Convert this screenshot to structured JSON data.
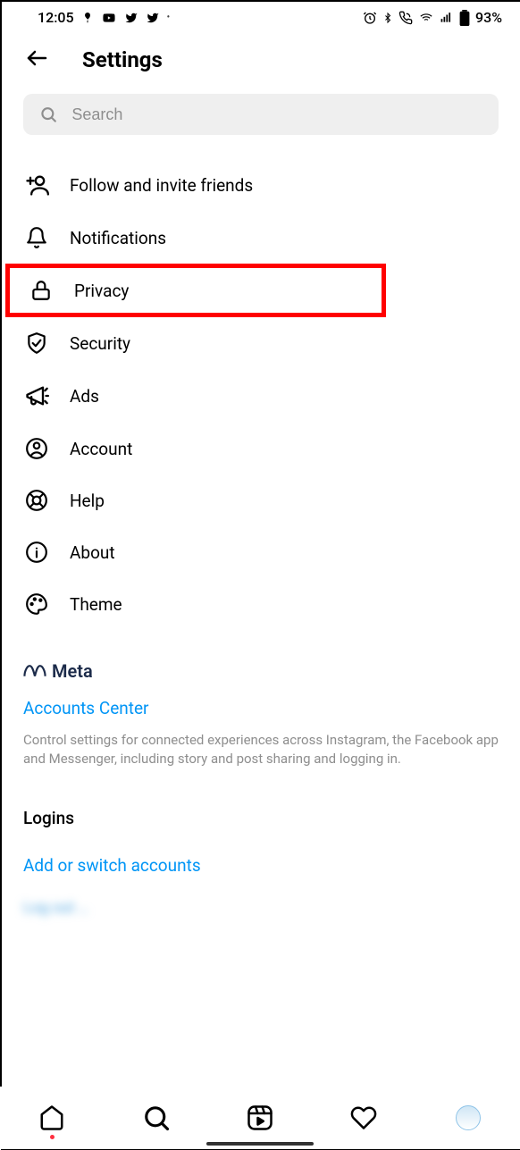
{
  "status": {
    "time": "12:05",
    "battery": "93%"
  },
  "header": {
    "title": "Settings"
  },
  "search": {
    "placeholder": "Search"
  },
  "items": [
    {
      "label": "Follow and invite friends"
    },
    {
      "label": "Notifications"
    },
    {
      "label": "Privacy"
    },
    {
      "label": "Security"
    },
    {
      "label": "Ads"
    },
    {
      "label": "Account"
    },
    {
      "label": "Help"
    },
    {
      "label": "About"
    },
    {
      "label": "Theme"
    }
  ],
  "meta": {
    "brand": "Meta"
  },
  "accounts_center": {
    "link": "Accounts Center",
    "description": "Control settings for connected experiences across Instagram, the Facebook app and Messenger, including story and post sharing and logging in."
  },
  "logins": {
    "title": "Logins",
    "add": "Add or switch accounts",
    "logout": "Log out …"
  }
}
